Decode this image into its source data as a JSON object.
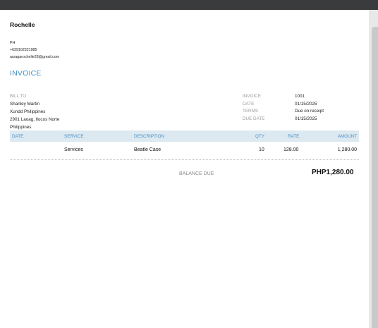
{
  "company": {
    "name": "Rochelle",
    "lines": [
      "PH",
      "+639102321985",
      "arzagarochelle28@gmail.com"
    ]
  },
  "invoice_title": "INVOICE",
  "bill_to": {
    "label": "BILL TO",
    "lines": [
      "Shanley Martin",
      "Xundd Philippines",
      "2901 Laoag, Ilocos Norte",
      "Philippines"
    ]
  },
  "meta": [
    {
      "label": "INVOICE",
      "value": "1001"
    },
    {
      "label": "DATE",
      "value": "01/15/2025"
    },
    {
      "label": "TERMS",
      "value": "Due on receipt"
    },
    {
      "label": "DUE DATE",
      "value": "01/15/2025"
    }
  ],
  "table": {
    "headers": {
      "date": "DATE",
      "service": "SERVICE",
      "description": "DESCRIPTION",
      "qty": "QTY",
      "rate": "RATE",
      "amount": "AMOUNT"
    },
    "rows": [
      {
        "date": "",
        "service": "Services",
        "description": "Beatle Case",
        "qty": "10",
        "rate": "128.00",
        "amount": "1,280.00"
      }
    ]
  },
  "balance": {
    "label": "BALANCE DUE",
    "value": "PHP1,280.00"
  },
  "colors": {
    "accent": "#3f8dbf",
    "header_bg": "#dce9f1",
    "topbar": "#3a3b3d"
  }
}
